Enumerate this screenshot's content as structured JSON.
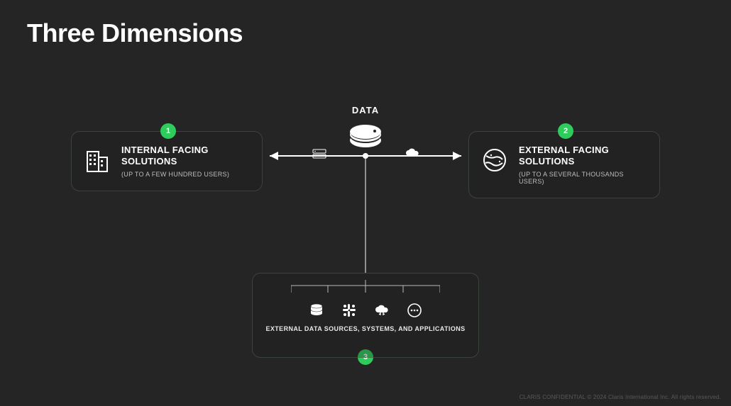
{
  "title": "Three Dimensions",
  "center": {
    "label": "DATA"
  },
  "dimensions": {
    "left": {
      "badge": "1",
      "title": "INTERNAL FACING SOLUTIONS",
      "subtitle": "(UP TO A FEW HUNDRED USERS)"
    },
    "right": {
      "badge": "2",
      "title": "EXTERNAL FACING SOLUTIONS",
      "subtitle": "(UP TO A SEVERAL THOUSANDS USERS)"
    },
    "bottom": {
      "badge": "3",
      "label": "EXTERNAL DATA SOURCES, SYSTEMS, AND APPLICATIONS"
    }
  },
  "footer": "CLARIS CONFIDENTIAL © 2024 Claris International Inc. All rights reserved.",
  "colors": {
    "accent": "#2ecc5a",
    "bg": "#252525"
  }
}
